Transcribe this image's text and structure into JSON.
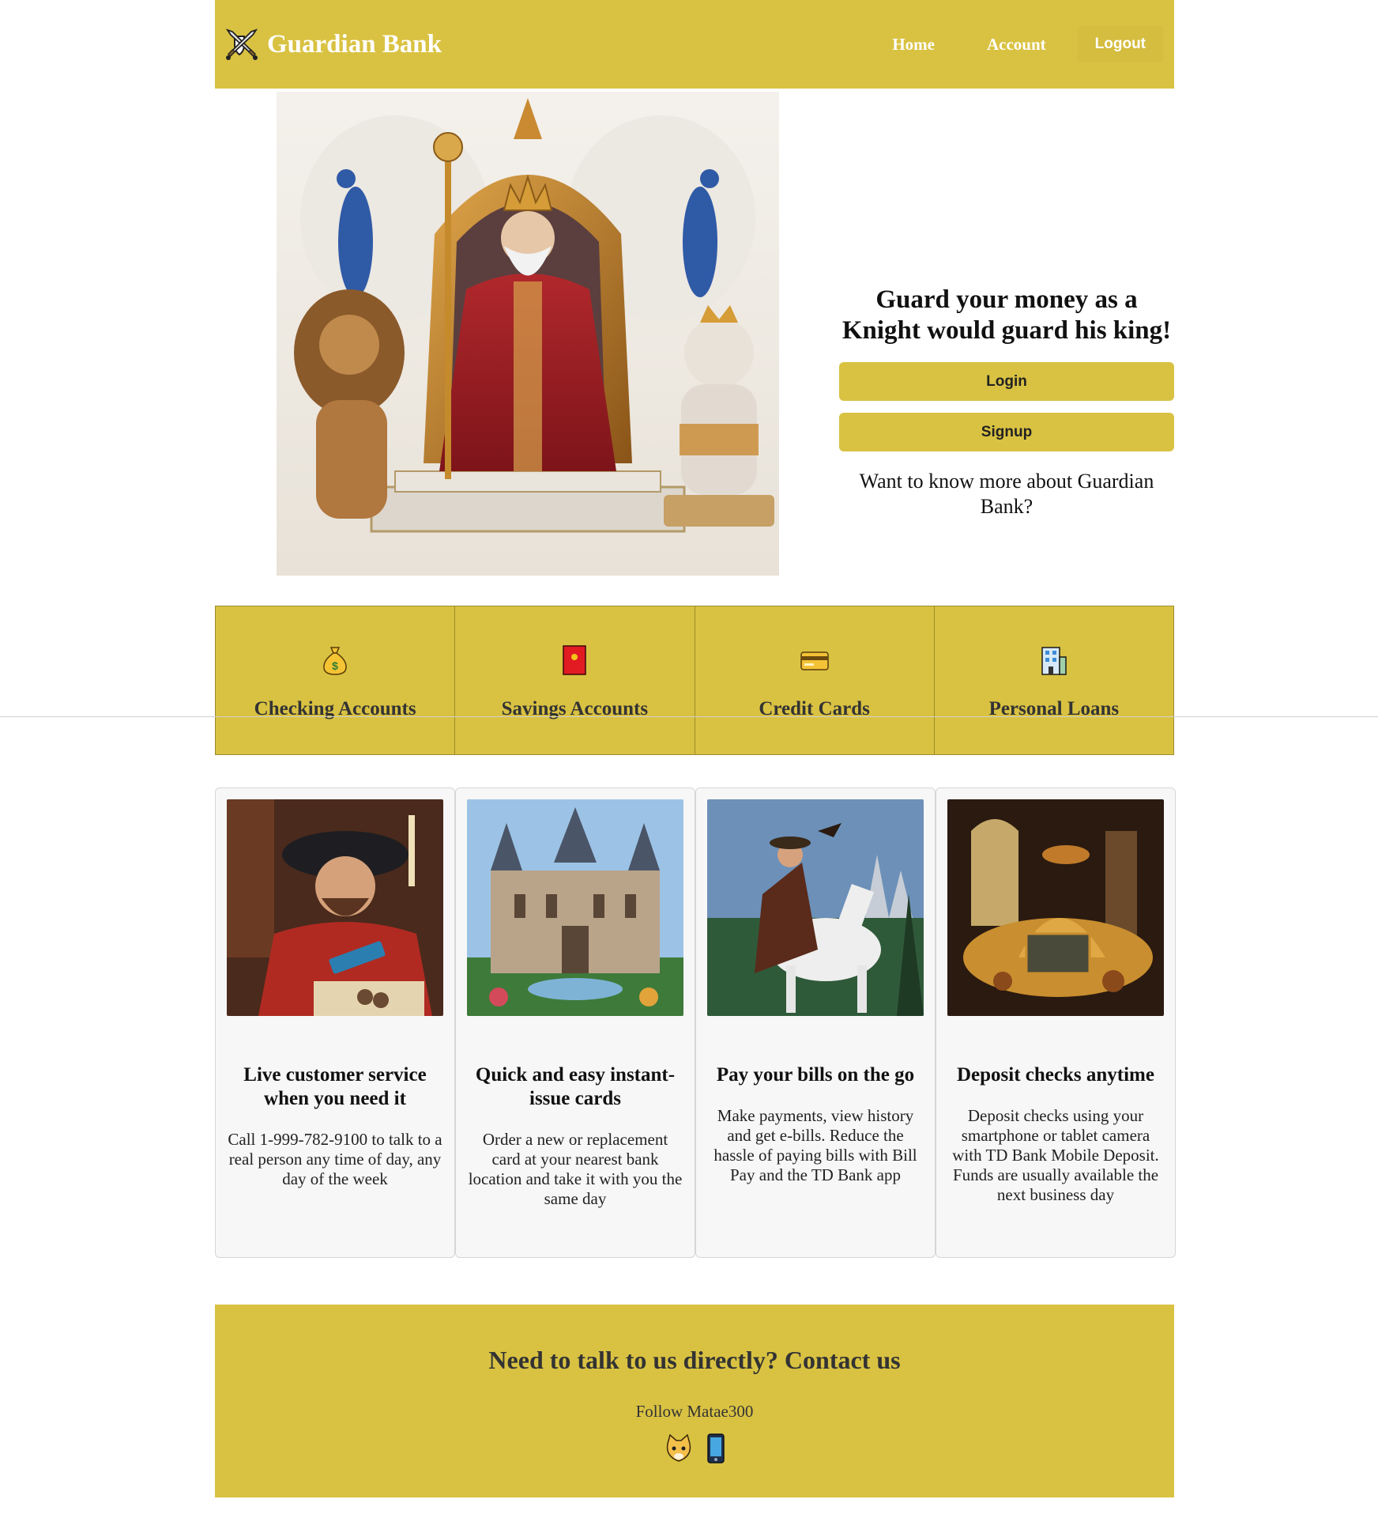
{
  "header": {
    "brand": "Guardian Bank",
    "brand_icon": "crossed-swords-shield-icon",
    "nav": {
      "home": "Home",
      "account": "Account",
      "logout": "Logout"
    }
  },
  "hero": {
    "image": "king-on-throne-with-lions-and-peacocks-image",
    "title": "Guard your money as a Knight would guard his king!",
    "login": "Login",
    "signup": "Signup",
    "more": "Want to know more about Guardian Bank?"
  },
  "services": [
    {
      "label": "Checking Accounts",
      "icon": "money-bag-icon"
    },
    {
      "label": "Savings Accounts",
      "icon": "red-envelope-icon"
    },
    {
      "label": "Credit Cards",
      "icon": "credit-card-icon"
    },
    {
      "label": "Personal Loans",
      "icon": "office-building-icon"
    }
  ],
  "cards": [
    {
      "image": "medieval-man-on-phone-image",
      "title": "Live customer service when you need it",
      "text": "Call 1-999-782-9100 to talk to a real person any time of day, any day of the week"
    },
    {
      "image": "gothic-palace-image",
      "title": "Quick and easy instant-issue cards",
      "text": "Order a new or replacement card at your nearest bank location and take it with you the same day"
    },
    {
      "image": "noble-on-white-horse-image",
      "title": "Pay your bills on the go",
      "text": "Make payments, view history and get e-bills. Reduce the hassle of paying bills with Bill Pay and the TD Bank app"
    },
    {
      "image": "treasure-vault-gold-coins-image",
      "title": "Deposit checks anytime",
      "text": "Deposit checks using your smartphone or tablet camera with TD Bank Mobile Deposit. Funds are usually available the next business day"
    }
  ],
  "footer": {
    "title": "Need to talk to us directly? Contact us",
    "follow": "Follow Matae300",
    "icons": [
      "cat-face-icon",
      "mobile-phone-icon"
    ]
  },
  "colors": {
    "accent": "#d9c242",
    "header_text": "#ffffff"
  }
}
